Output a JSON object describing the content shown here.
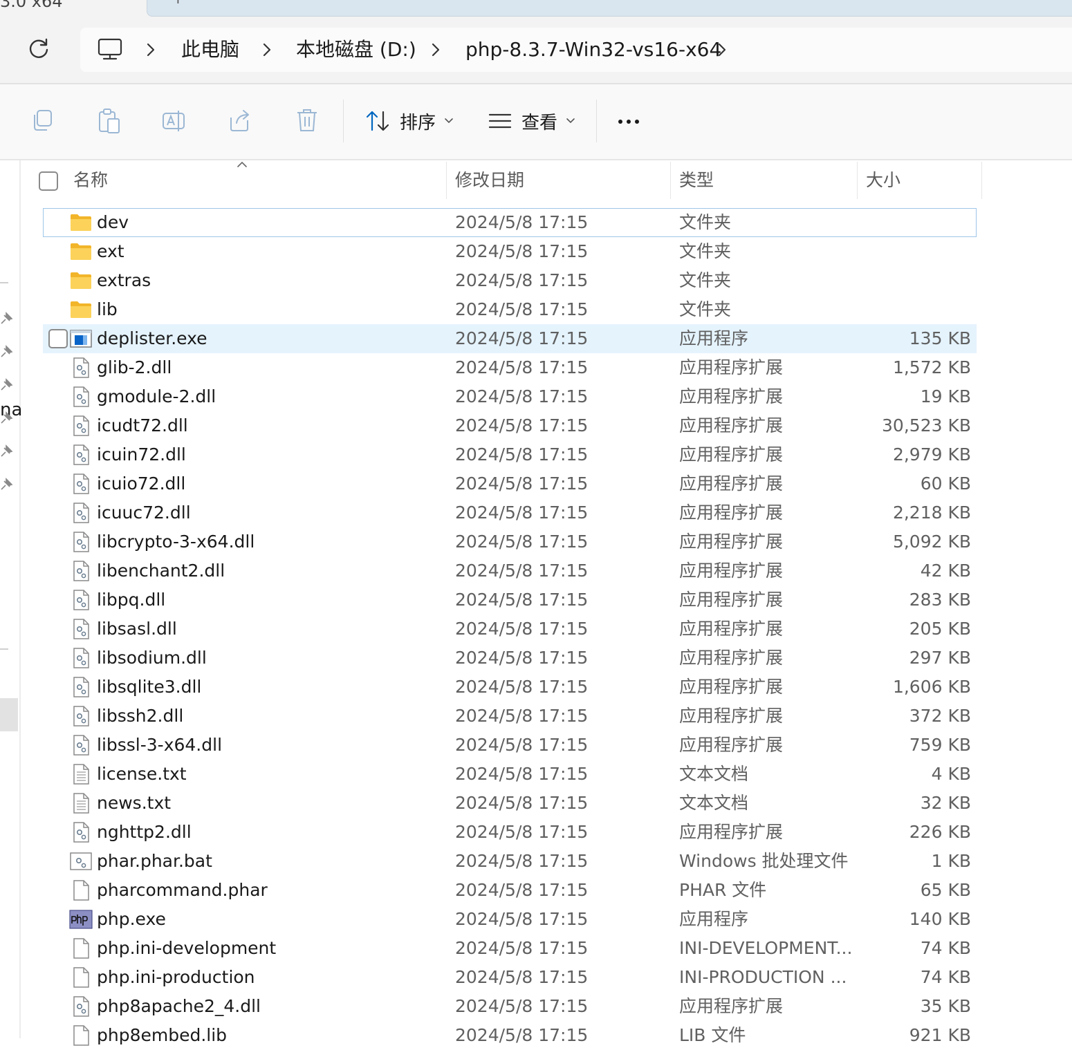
{
  "tabs": {
    "prev_tab_fragment": "3.0 x64",
    "new_tab_symbol": "+"
  },
  "address": {
    "refresh_icon": "refresh-icon",
    "root_icon": "computer-icon",
    "crumbs": [
      "此电脑",
      "本地磁盘 (D:)",
      "php-8.3.7-Win32-vs16-x64"
    ]
  },
  "toolbar": {
    "icons": [
      "copy-icon",
      "paste-icon",
      "rename-icon",
      "share-icon",
      "delete-icon"
    ],
    "sort_label": "排序",
    "view_label": "查看",
    "more_icon": "more-icon"
  },
  "nav": {
    "visible_fragment": "na"
  },
  "columns": {
    "name": "名称",
    "modified": "修改日期",
    "type": "类型",
    "size": "大小"
  },
  "files": [
    {
      "name": "dev",
      "date": "2024/5/8 17:15",
      "type": "文件夹",
      "size": "",
      "icon": "folder"
    },
    {
      "name": "ext",
      "date": "2024/5/8 17:15",
      "type": "文件夹",
      "size": "",
      "icon": "folder"
    },
    {
      "name": "extras",
      "date": "2024/5/8 17:15",
      "type": "文件夹",
      "size": "",
      "icon": "folder"
    },
    {
      "name": "lib",
      "date": "2024/5/8 17:15",
      "type": "文件夹",
      "size": "",
      "icon": "folder"
    },
    {
      "name": "deplister.exe",
      "date": "2024/5/8 17:15",
      "type": "应用程序",
      "size": "135 KB",
      "icon": "exe"
    },
    {
      "name": "glib-2.dll",
      "date": "2024/5/8 17:15",
      "type": "应用程序扩展",
      "size": "1,572 KB",
      "icon": "dll"
    },
    {
      "name": "gmodule-2.dll",
      "date": "2024/5/8 17:15",
      "type": "应用程序扩展",
      "size": "19 KB",
      "icon": "dll"
    },
    {
      "name": "icudt72.dll",
      "date": "2024/5/8 17:15",
      "type": "应用程序扩展",
      "size": "30,523 KB",
      "icon": "dll"
    },
    {
      "name": "icuin72.dll",
      "date": "2024/5/8 17:15",
      "type": "应用程序扩展",
      "size": "2,979 KB",
      "icon": "dll"
    },
    {
      "name": "icuio72.dll",
      "date": "2024/5/8 17:15",
      "type": "应用程序扩展",
      "size": "60 KB",
      "icon": "dll"
    },
    {
      "name": "icuuc72.dll",
      "date": "2024/5/8 17:15",
      "type": "应用程序扩展",
      "size": "2,218 KB",
      "icon": "dll"
    },
    {
      "name": "libcrypto-3-x64.dll",
      "date": "2024/5/8 17:15",
      "type": "应用程序扩展",
      "size": "5,092 KB",
      "icon": "dll"
    },
    {
      "name": "libenchant2.dll",
      "date": "2024/5/8 17:15",
      "type": "应用程序扩展",
      "size": "42 KB",
      "icon": "dll"
    },
    {
      "name": "libpq.dll",
      "date": "2024/5/8 17:15",
      "type": "应用程序扩展",
      "size": "283 KB",
      "icon": "dll"
    },
    {
      "name": "libsasl.dll",
      "date": "2024/5/8 17:15",
      "type": "应用程序扩展",
      "size": "205 KB",
      "icon": "dll"
    },
    {
      "name": "libsodium.dll",
      "date": "2024/5/8 17:15",
      "type": "应用程序扩展",
      "size": "297 KB",
      "icon": "dll"
    },
    {
      "name": "libsqlite3.dll",
      "date": "2024/5/8 17:15",
      "type": "应用程序扩展",
      "size": "1,606 KB",
      "icon": "dll"
    },
    {
      "name": "libssh2.dll",
      "date": "2024/5/8 17:15",
      "type": "应用程序扩展",
      "size": "372 KB",
      "icon": "dll"
    },
    {
      "name": "libssl-3-x64.dll",
      "date": "2024/5/8 17:15",
      "type": "应用程序扩展",
      "size": "759 KB",
      "icon": "dll"
    },
    {
      "name": "license.txt",
      "date": "2024/5/8 17:15",
      "type": "文本文档",
      "size": "4 KB",
      "icon": "txt"
    },
    {
      "name": "news.txt",
      "date": "2024/5/8 17:15",
      "type": "文本文档",
      "size": "32 KB",
      "icon": "txt"
    },
    {
      "name": "nghttp2.dll",
      "date": "2024/5/8 17:15",
      "type": "应用程序扩展",
      "size": "226 KB",
      "icon": "dll"
    },
    {
      "name": "phar.phar.bat",
      "date": "2024/5/8 17:15",
      "type": "Windows 批处理文件",
      "size": "1 KB",
      "icon": "bat"
    },
    {
      "name": "pharcommand.phar",
      "date": "2024/5/8 17:15",
      "type": "PHAR 文件",
      "size": "65 KB",
      "icon": "blank"
    },
    {
      "name": "php.exe",
      "date": "2024/5/8 17:15",
      "type": "应用程序",
      "size": "140 KB",
      "icon": "php"
    },
    {
      "name": "php.ini-development",
      "date": "2024/5/8 17:15",
      "type": "INI-DEVELOPMENT...",
      "size": "74 KB",
      "icon": "blank"
    },
    {
      "name": "php.ini-production",
      "date": "2024/5/8 17:15",
      "type": "INI-PRODUCTION ...",
      "size": "74 KB",
      "icon": "blank"
    },
    {
      "name": "php8apache2_4.dll",
      "date": "2024/5/8 17:15",
      "type": "应用程序扩展",
      "size": "35 KB",
      "icon": "dll"
    },
    {
      "name": "php8embed.lib",
      "date": "2024/5/8 17:15",
      "type": "LIB 文件",
      "size": "921 KB",
      "icon": "blank"
    }
  ],
  "state": {
    "focused_row": 0,
    "hovered_row": 4
  },
  "colors": {
    "accent": "#0067c0",
    "folder": "#f8c43c",
    "hover": "#e5f3fd",
    "focus": "#9ec6e8"
  }
}
